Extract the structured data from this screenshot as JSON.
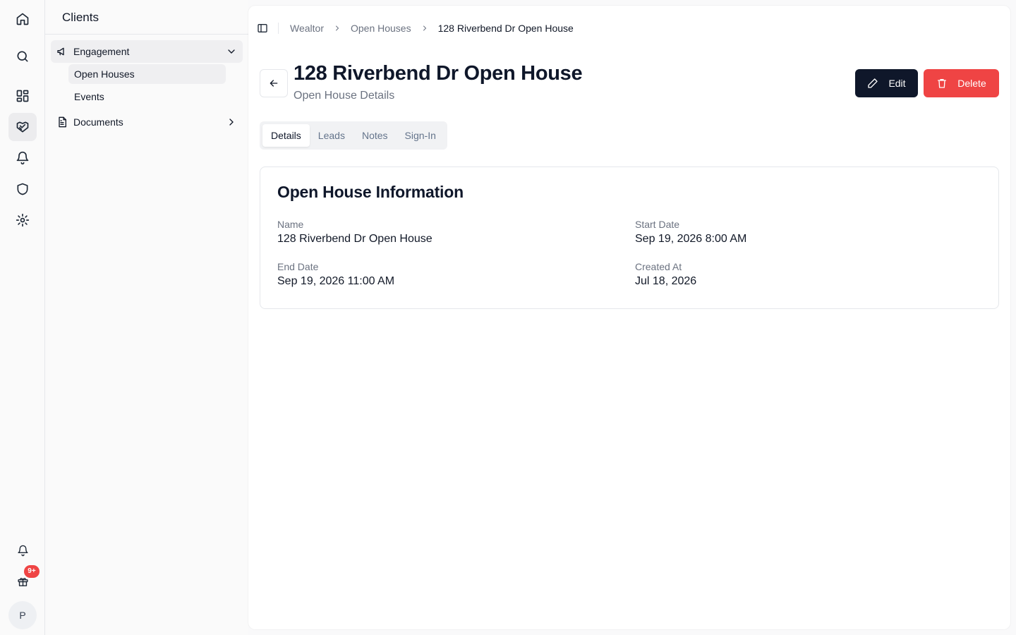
{
  "rail": {
    "items": [
      {
        "icon": "home-icon"
      },
      {
        "icon": "search-icon"
      },
      {
        "icon": "dashboard-icon"
      },
      {
        "icon": "handshake-icon",
        "active": true
      },
      {
        "icon": "bell-icon"
      },
      {
        "icon": "shield-icon"
      },
      {
        "icon": "gear-icon"
      }
    ],
    "bottom": {
      "notifications_icon": "bell-icon",
      "gift_icon": "gift-icon",
      "gift_badge": "9+",
      "avatar_initial": "P"
    }
  },
  "sidebar": {
    "title": "Clients",
    "group": {
      "label": "Engagement",
      "icon": "megaphone-icon",
      "expanded": true
    },
    "sub_items": [
      {
        "label": "Open Houses",
        "active": true
      },
      {
        "label": "Events",
        "active": false
      }
    ],
    "documents": {
      "label": "Documents",
      "icon": "document-icon"
    }
  },
  "breadcrumb": [
    "Wealtor",
    "Open Houses",
    "128 Riverbend Dr Open House"
  ],
  "header": {
    "title": "128 Riverbend Dr Open House",
    "subtitle": "Open House Details",
    "edit_label": "Edit",
    "delete_label": "Delete"
  },
  "tabs": [
    {
      "label": "Details",
      "active": true
    },
    {
      "label": "Leads",
      "active": false
    },
    {
      "label": "Notes",
      "active": false
    },
    {
      "label": "Sign-In",
      "active": false
    }
  ],
  "card": {
    "title": "Open House Information",
    "fields": {
      "name": {
        "label": "Name",
        "value": "128 Riverbend Dr Open House"
      },
      "start_date": {
        "label": "Start Date",
        "value": "Sep 19, 2026 8:00 AM"
      },
      "end_date": {
        "label": "End Date",
        "value": "Sep 19, 2026 11:00 AM"
      },
      "created_at": {
        "label": "Created At",
        "value": "Jul 18, 2026"
      }
    }
  },
  "colors": {
    "primary": "#0f172a",
    "danger": "#ef4444",
    "muted_text": "#6b7280",
    "border": "#e5e7eb"
  }
}
